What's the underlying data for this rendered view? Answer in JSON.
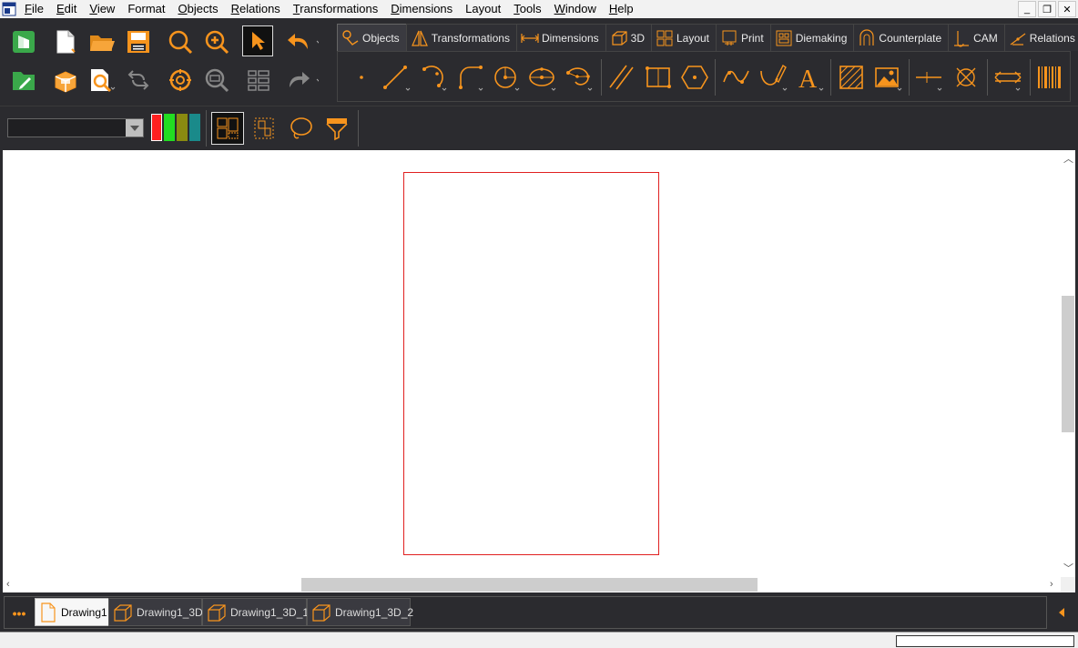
{
  "menubar": {
    "items": [
      "File",
      "Edit",
      "View",
      "Format",
      "Objects",
      "Relations",
      "Transformations",
      "Dimensions",
      "Layout",
      "Tools",
      "Window",
      "Help"
    ],
    "mnemonics": [
      "F",
      "E",
      "V",
      "",
      "O",
      "R",
      "T",
      "D",
      "",
      "T",
      "W",
      "H"
    ]
  },
  "window_controls": {
    "minimize": "_",
    "restore": "❐",
    "close": "✕"
  },
  "ribbon": {
    "tabs": [
      {
        "label": "Objects",
        "icon": "objects-icon"
      },
      {
        "label": "Transformations",
        "icon": "transformations-icon"
      },
      {
        "label": "Dimensions",
        "icon": "dimensions-icon"
      },
      {
        "label": "3D",
        "icon": "cube-icon"
      },
      {
        "label": "Layout",
        "icon": "layout-icon"
      },
      {
        "label": "Print",
        "icon": "print-icon"
      },
      {
        "label": "Diemaking",
        "icon": "diemaking-icon"
      },
      {
        "label": "Counterplate",
        "icon": "counterplate-icon"
      },
      {
        "label": "CAM",
        "icon": "cam-icon"
      },
      {
        "label": "Relations",
        "icon": "relations-icon"
      }
    ],
    "active_tab": "Objects"
  },
  "toolbar2": {
    "layer_combo_value": "",
    "color_swatches": [
      "#ff2020",
      "#22dd22",
      "#8a8a10",
      "#1a8a8a"
    ]
  },
  "document_tabs": [
    {
      "label": "Drawing1",
      "icon": "page-icon",
      "active": true
    },
    {
      "label": "Drawing1_3D",
      "icon": "cube-icon",
      "active": false
    },
    {
      "label": "Drawing1_3D_1",
      "icon": "cube-icon",
      "active": false
    },
    {
      "label": "Drawing1_3D_2",
      "icon": "cube-icon",
      "active": false
    }
  ],
  "document_tabs_more": "•••",
  "colors": {
    "accent": "#f7941d",
    "brand_green": "#3aa84a",
    "page_border": "#e02020",
    "toolbar_bg": "#2b2b2f"
  }
}
